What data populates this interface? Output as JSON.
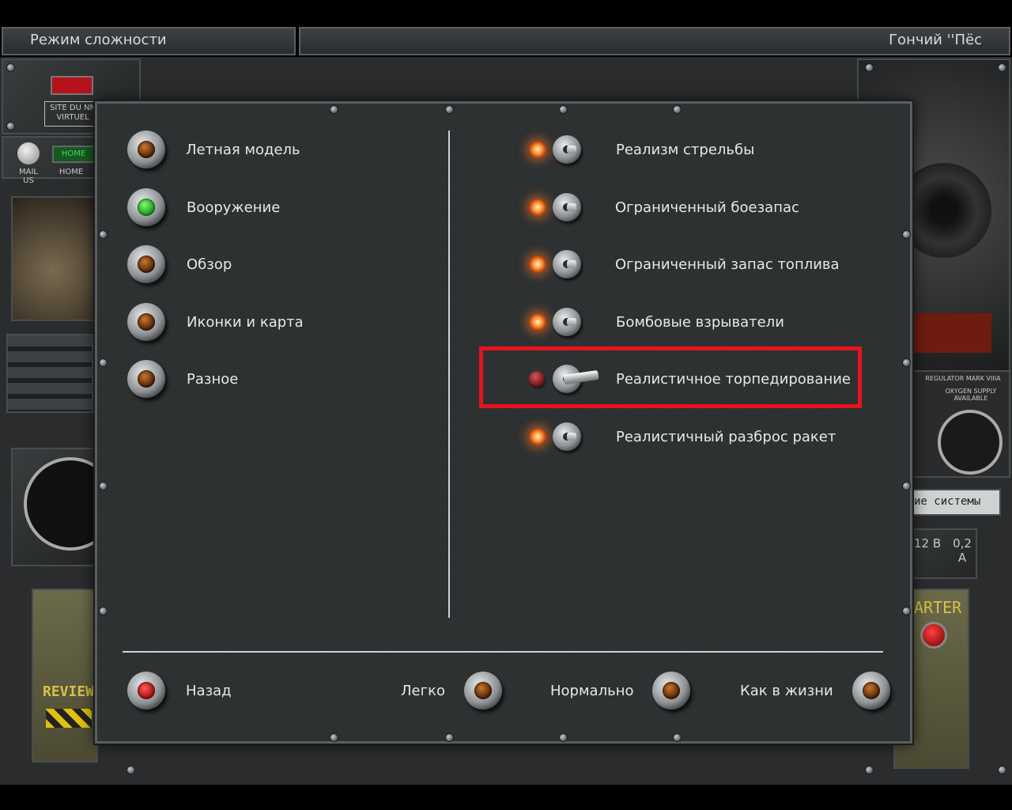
{
  "header": {
    "left_title": "Режим сложности",
    "right_title": "Гончий ''Пёс"
  },
  "background": {
    "site_label": "SITE DU NN VIRTUEL",
    "mail_label": "MAIL US",
    "home_button": "HOME",
    "home_label": "HOME",
    "review_label": "REVIEW",
    "starter_label": "ARTER",
    "regulator_label": "REGULATOR MARK VIIIA",
    "oxygen_label": "OXYGEN SUPPLY AVAILABLE",
    "systems_label": "ие системы",
    "voltage_label": "12 В",
    "current_label": "0,2 А"
  },
  "left_column": [
    {
      "label": "Летная модель",
      "lamp": "amber"
    },
    {
      "label": "Вооружение",
      "lamp": "green"
    },
    {
      "label": "Обзор",
      "lamp": "amber"
    },
    {
      "label": "Иконки и карта",
      "lamp": "amber"
    },
    {
      "label": "Разное",
      "lamp": "amber"
    }
  ],
  "right_column": [
    {
      "label": "Реализм стрельбы",
      "state": "on"
    },
    {
      "label": "Ограниченный боезапас",
      "state": "on"
    },
    {
      "label": "Ограниченный запас топлива",
      "state": "on"
    },
    {
      "label": "Бомбовые взрыватели",
      "state": "on"
    },
    {
      "label": "Реалистичное торпедирование",
      "state": "off"
    },
    {
      "label": "Реалистичный разброс ракет",
      "state": "on"
    }
  ],
  "footer": {
    "back": "Назад",
    "easy": "Легко",
    "normal": "Нормально",
    "realistic": "Как в жизни"
  },
  "colors": {
    "highlight": "#e8121e",
    "lamp_green": "#13941a",
    "lamp_red": "#a00b0b",
    "led_on": "#ff9a3c"
  }
}
